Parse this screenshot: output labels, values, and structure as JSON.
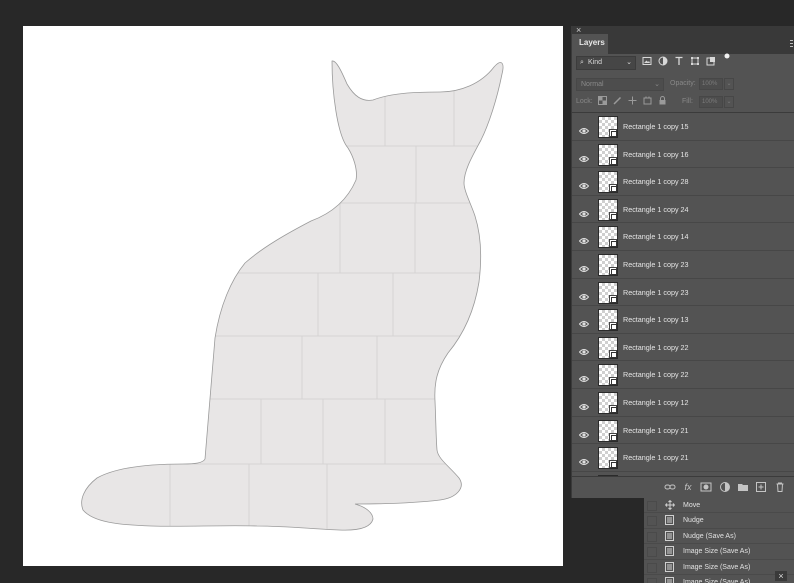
{
  "layers_panel": {
    "close_glyph": "×",
    "tab_label": "Layers",
    "menu_glyph": "≡",
    "filter": {
      "kind_label": "Kind",
      "search_glyph": "⌕",
      "chevron": "⌄"
    },
    "filter_icons": [
      "image-filter-icon",
      "adjustment-filter-icon",
      "type-filter-icon",
      "shape-filter-icon",
      "smart-object-filter-icon",
      "filter-toggle-icon"
    ],
    "blend_mode": "Normal",
    "opacity_label": "Opacity:",
    "opacity_value": "100%",
    "lock_label": "Lock:",
    "fill_label": "Fill:",
    "fill_value": "100%",
    "layers": [
      {
        "name": "Rectangle 1 copy 15"
      },
      {
        "name": "Rectangle 1 copy 16"
      },
      {
        "name": "Rectangle 1 copy 28"
      },
      {
        "name": "Rectangle 1 copy 24"
      },
      {
        "name": "Rectangle 1 copy 14"
      },
      {
        "name": "Rectangle 1 copy 23"
      },
      {
        "name": "Rectangle 1 copy 23"
      },
      {
        "name": "Rectangle 1 copy 13"
      },
      {
        "name": "Rectangle 1 copy 22"
      },
      {
        "name": "Rectangle 1 copy 22"
      },
      {
        "name": "Rectangle 1 copy 12"
      },
      {
        "name": "Rectangle 1 copy 21"
      },
      {
        "name": "Rectangle 1 copy 21"
      }
    ],
    "footer_fx": "fx"
  },
  "actions_panel": {
    "items": [
      {
        "label": "Move",
        "icon": "move-icon"
      },
      {
        "label": "Nudge",
        "icon": "dialog-icon"
      },
      {
        "label": "Nudge (Save As)",
        "icon": "dialog-icon"
      },
      {
        "label": "Image Size (Save As)",
        "icon": "dialog-icon"
      },
      {
        "label": "Image Size (Save As)",
        "icon": "dialog-icon"
      },
      {
        "label": "Image Size (Save As)",
        "icon": "dialog-icon"
      }
    ],
    "close_glyph": "×"
  },
  "colors": {
    "workspace": "#282828",
    "panel": "#535353",
    "shape_fill": "#e8e6e6"
  }
}
